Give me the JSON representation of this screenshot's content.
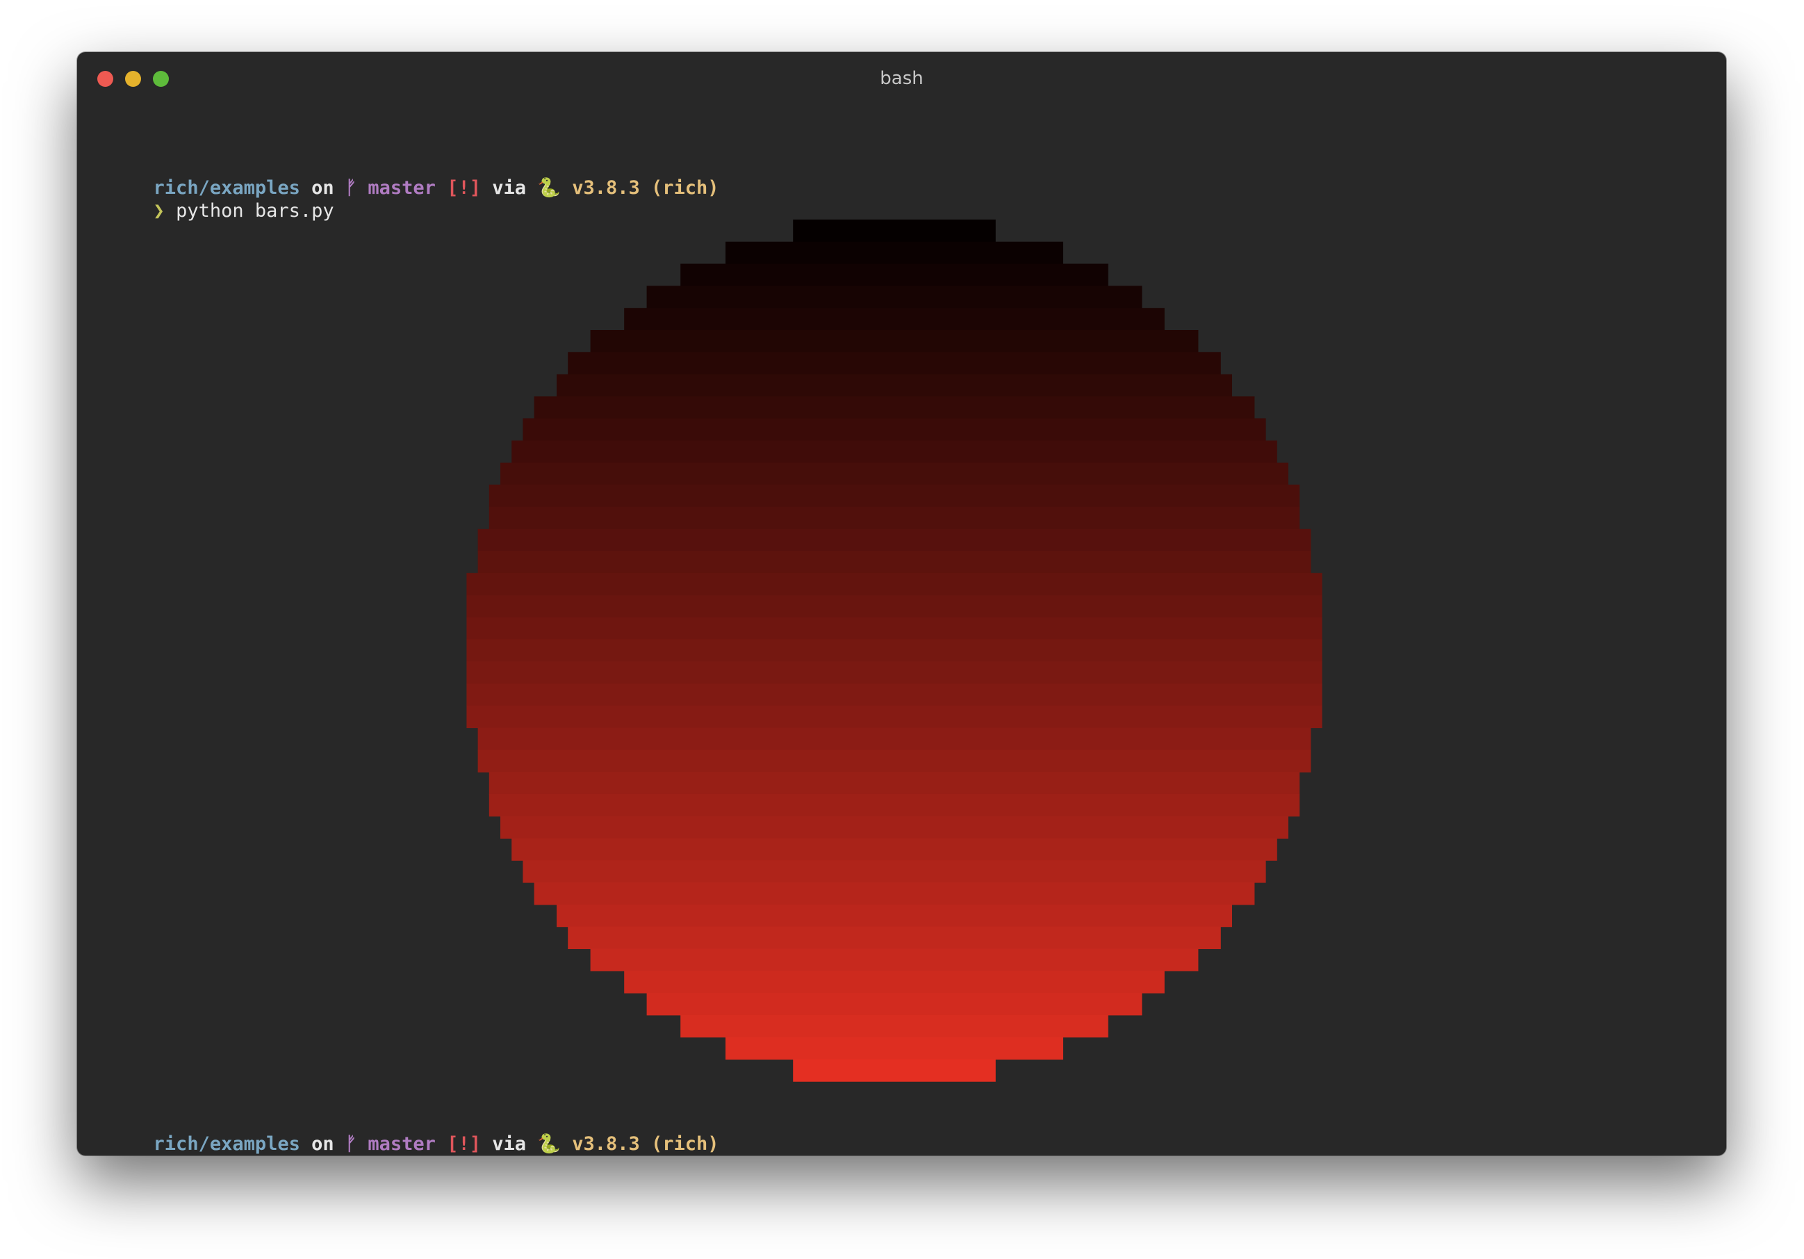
{
  "window": {
    "title": "bash"
  },
  "colors": {
    "path": "#7aa6c2",
    "branch": "#b07cc2",
    "status": "#e0565b",
    "python": "#e5c07b",
    "chevron": "#c3c45a",
    "text": "#e6e6e6",
    "background": "#282828",
    "gradient_top": "#050000",
    "gradient_bottom": "#e42f22"
  },
  "prompts": [
    {
      "path": "rich/examples",
      "on": "on",
      "branch_icon": "ᚠ",
      "branch": "master",
      "status": "[!]",
      "via": "via",
      "python_icon": "🐍",
      "python_version": "v3.8.3",
      "env": "(rich)"
    },
    {
      "path": "rich/examples",
      "on": "on",
      "branch_icon": "ᚠ",
      "branch": "master",
      "status": "[!]",
      "via": "via",
      "python_icon": "🐍",
      "python_version": "v3.8.3",
      "env": "(rich)"
    }
  ],
  "chevron": "❯",
  "command": "python bars.py",
  "output": {
    "description_icon": "gradient-circle",
    "rows": 39
  }
}
